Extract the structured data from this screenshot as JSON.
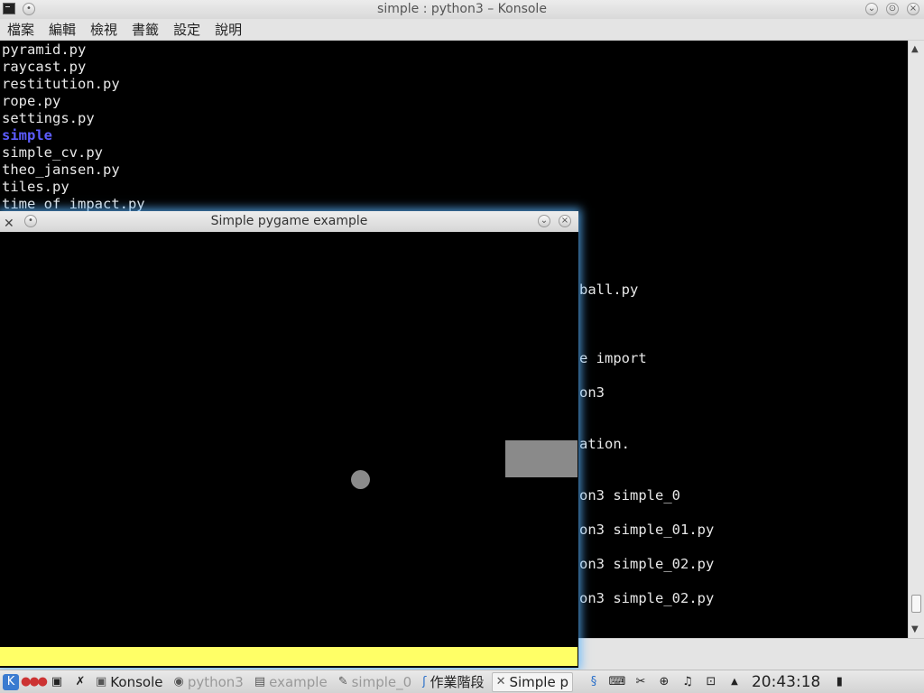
{
  "konsole": {
    "title": "simple : python3 – Konsole",
    "menu": [
      "檔案",
      "編輯",
      "檢視",
      "書籤",
      "設定",
      "說明"
    ],
    "terminal_lines_top": [
      "pyramid.py",
      "raycast.py",
      "restitution.py",
      "rope.py",
      "settings.py",
      "simple",
      "simple_cv.py",
      "theo_jansen.py",
      "tiles.py",
      "time_of_impact.py"
    ],
    "terminal_lines_right": [
      "ball.py",
      "e import",
      "on3",
      "ation.",
      "on3 simple_0",
      "on3 simple_01.py",
      "on3 simple_02.py",
      "on3 simple_02.py"
    ]
  },
  "pygame": {
    "title": "Simple pygame example",
    "colors": {
      "ball": "#8a8a8a",
      "box": "#8a8a8a",
      "ground": "#ffff66",
      "background": "#000000"
    }
  },
  "taskbar": {
    "items": [
      {
        "label": "Konsole",
        "state": "normal"
      },
      {
        "label": "python3",
        "state": "inactive"
      },
      {
        "label": "example",
        "state": "inactive"
      },
      {
        "label": "simple_0",
        "state": "inactive"
      },
      {
        "label": "作業階段",
        "state": "normal"
      },
      {
        "label": "Simple p",
        "state": "active"
      }
    ],
    "clock": "20:43:18"
  }
}
